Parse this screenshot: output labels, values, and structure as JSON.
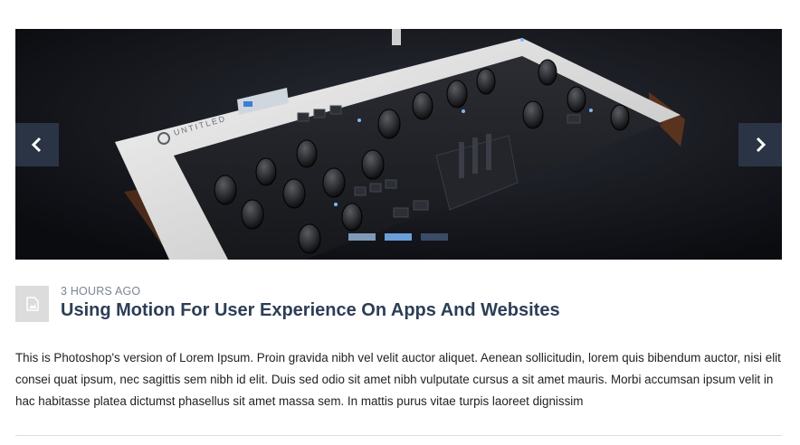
{
  "slider": {
    "product_brand": "UNTITLED",
    "prev_icon": "chevron-left-icon",
    "next_icon": "chevron-right-icon",
    "dots": 3,
    "active_dot": 1,
    "colors": {
      "nav_bg": "#2a3444",
      "dot_active": "#6a9fd8",
      "dot_inactive": "#3a4c66"
    }
  },
  "post": {
    "thumb_icon": "image-placeholder-icon",
    "timestamp": "3 HOURS AGO",
    "title": "Using Motion For User Experience On Apps And Websites",
    "excerpt": "This is Photoshop's version of Lorem Ipsum. Proin gravida nibh vel velit auctor aliquet. Aenean sollicitudin, lorem quis bibendum auctor, nisi elit consei quat ipsum, nec sagittis sem nibh id elit. Duis sed odio sit amet nibh vulputate cursus a sit amet mauris. Morbi accumsan ipsum velit in hac habitasse platea dictumst phasellus sit amet massa sem. In mattis purus vitae turpis laoreet dignissim",
    "colors": {
      "title": "#2c3e56",
      "meta": "#7a8595"
    }
  }
}
